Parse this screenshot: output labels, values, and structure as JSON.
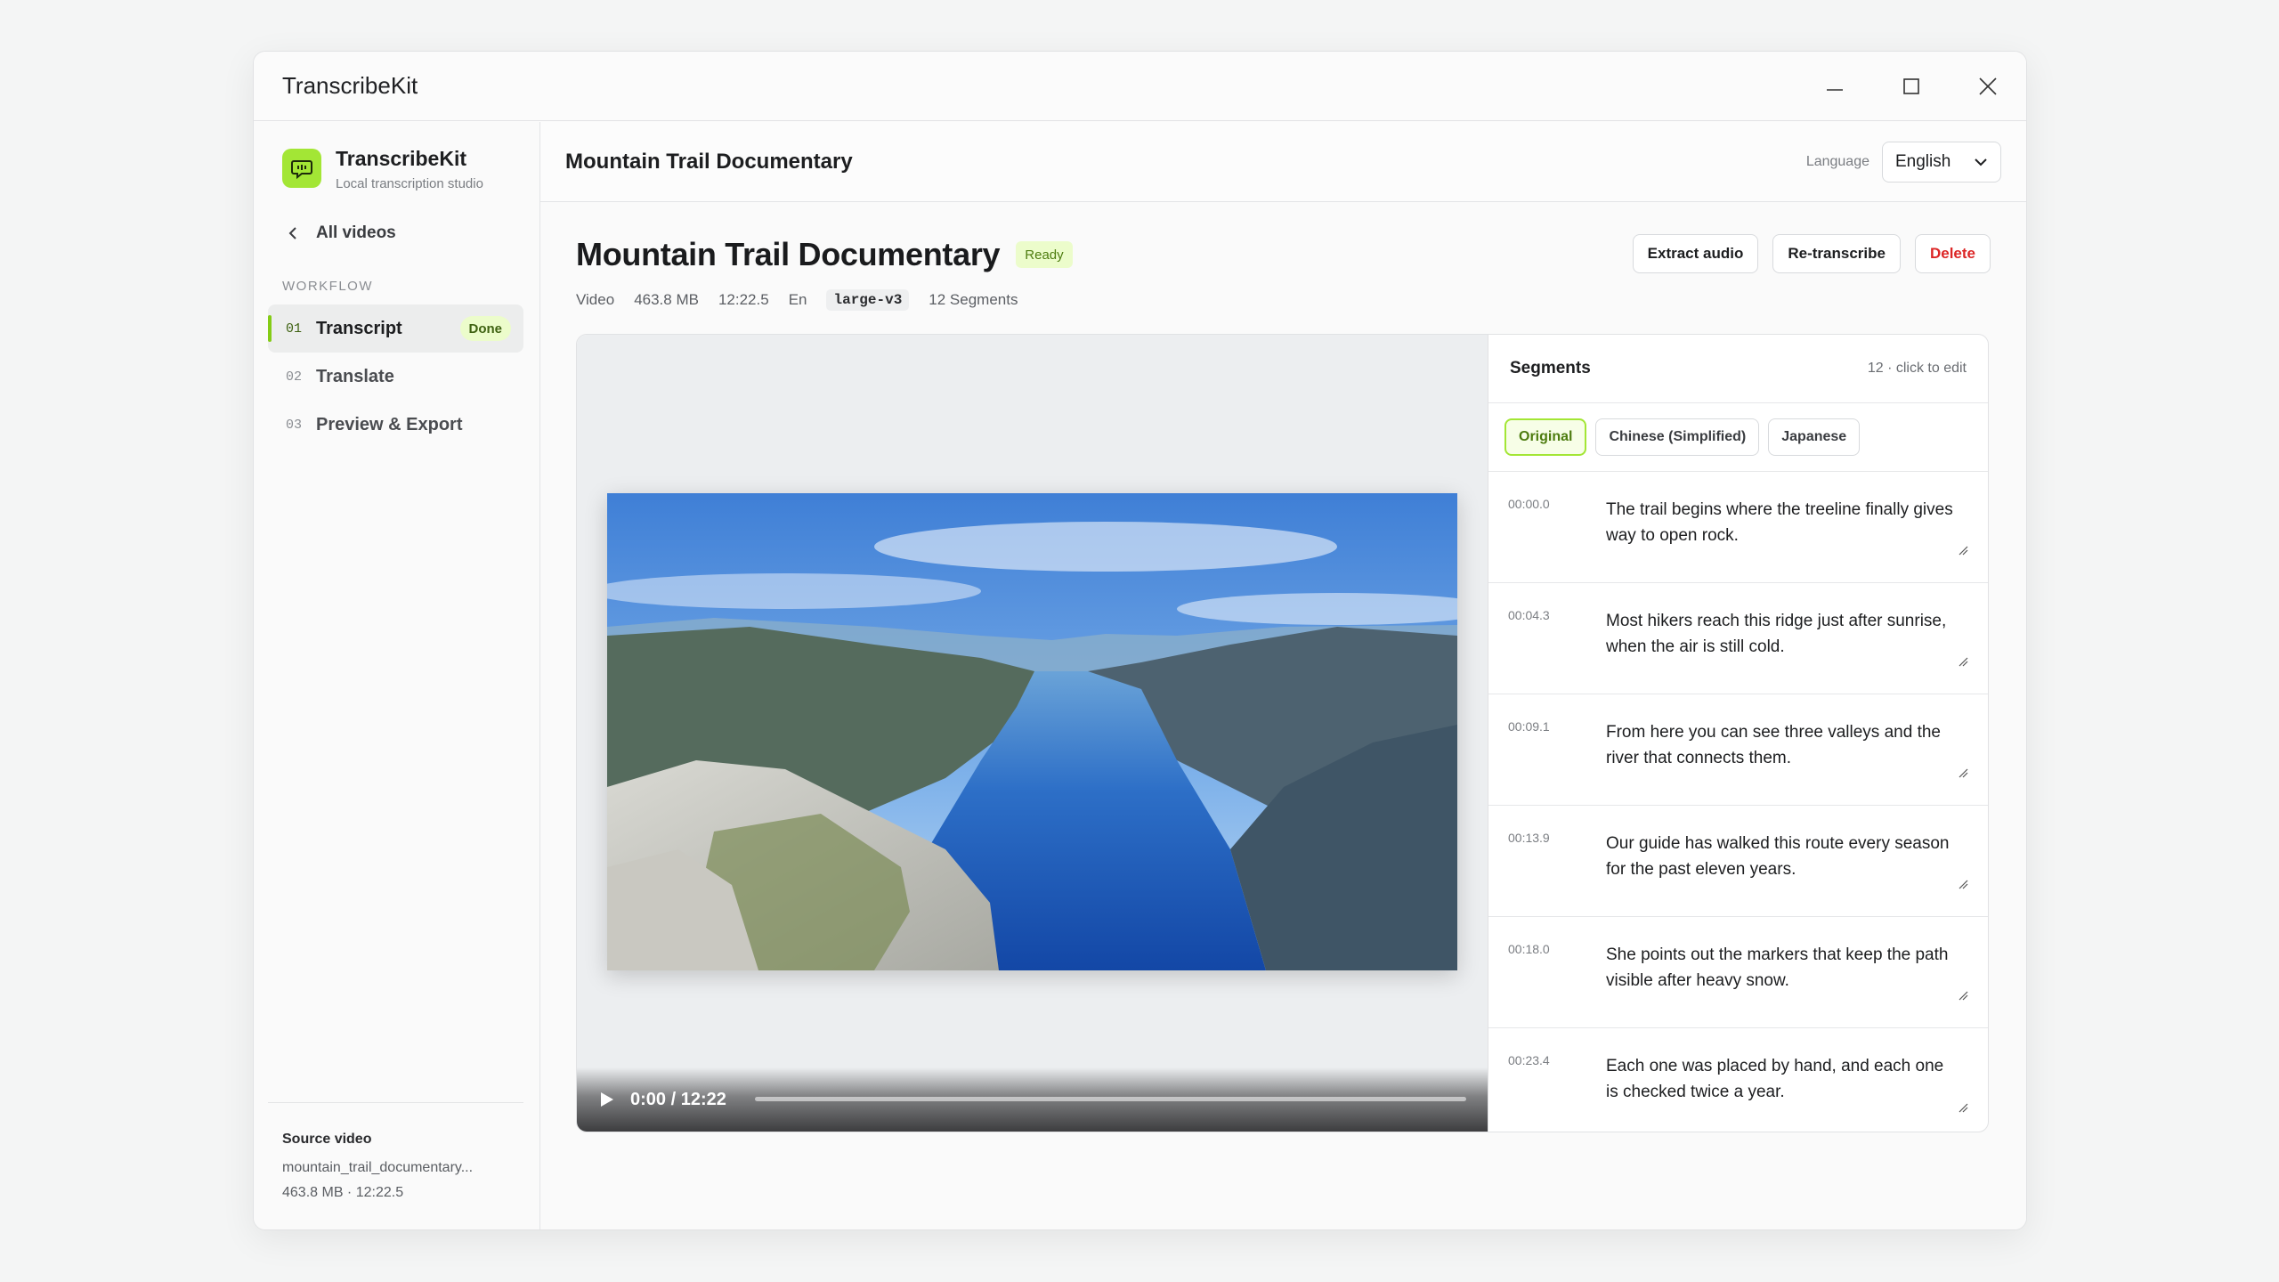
{
  "window": {
    "title": "TranscribeKit"
  },
  "sidebar": {
    "brand_name": "TranscribeKit",
    "brand_sub": "Local transcription studio",
    "back_label": "All videos",
    "section_label": "WORKFLOW",
    "items": [
      {
        "num": "01",
        "label": "Transcript",
        "badge": "Done"
      },
      {
        "num": "02",
        "label": "Translate"
      },
      {
        "num": "03",
        "label": "Preview & Export"
      }
    ],
    "source_title": "Source video",
    "source_file": "mountain_trail_documentary...",
    "source_meta": "463.8 MB · 12:22.5"
  },
  "header": {
    "crumb": "Mountain Trail Documentary",
    "language_label": "Language",
    "language_value": "English"
  },
  "page": {
    "title": "Mountain Trail Documentary",
    "status": "Ready",
    "meta": {
      "type": "Video",
      "size": "463.8 MB",
      "duration": "12:22.5",
      "lang": "En",
      "model": "large-v3",
      "segments": "12 Segments"
    },
    "actions": {
      "extract": "Extract audio",
      "retranscribe": "Re-transcribe",
      "delete": "Delete"
    }
  },
  "player": {
    "time": "0:00 / 12:22",
    "progress": 0
  },
  "segments_panel": {
    "title": "Segments",
    "count": "12 · click to edit",
    "tabs": [
      "Original",
      "Chinese (Simplified)",
      "Japanese"
    ],
    "rows": [
      {
        "time": "00:00.0",
        "text": "The trail begins where the treeline finally gives way to open rock."
      },
      {
        "time": "00:04.3",
        "text": "Most hikers reach this ridge just after sunrise, when the air is still cold."
      },
      {
        "time": "00:09.1",
        "text": "From here you can see three valleys and the river that connects them."
      },
      {
        "time": "00:13.9",
        "text": "Our guide has walked this route every season for the past eleven years."
      },
      {
        "time": "00:18.0",
        "text": "She points out the markers that keep the path visible after heavy snow."
      },
      {
        "time": "00:23.4",
        "text": "Each one was placed by hand, and each one is checked twice a year."
      }
    ]
  },
  "colors": {
    "accent": "#a3e635",
    "accent_dark": "#4d7c0f",
    "danger": "#dc2626"
  }
}
